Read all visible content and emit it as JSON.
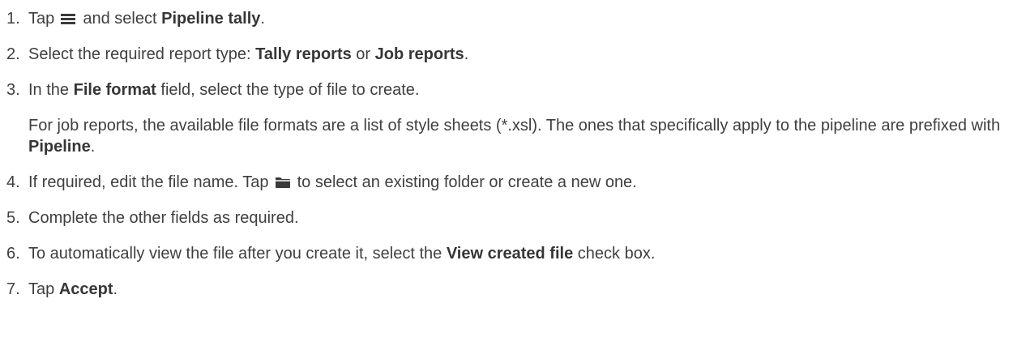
{
  "steps": [
    {
      "number": "1.",
      "text_before": "Tap",
      "icon": "menu-icon",
      "text_mid": "and select",
      "bold": "Pipeline tally",
      "text_after": "."
    },
    {
      "number": "2.",
      "text_before": "Select the required report type:",
      "bold1": "Tally reports",
      "text_mid": "or",
      "bold2": "Job reports",
      "text_after": "."
    },
    {
      "number": "3.",
      "text_before": "In the",
      "bold": "File format",
      "text_after": "field, select the type of file to create.",
      "note_text": "For job reports, the available file formats are a list of style sheets (*.xsl). The ones that specifically apply to the pipeline are prefixed with",
      "note_bold": "Pipeline",
      "note_after": "."
    },
    {
      "number": "4.",
      "text_before": "If required, edit the file name. Tap",
      "icon": "folder-icon",
      "text_after": "to select an existing folder or create a new one."
    },
    {
      "number": "5.",
      "text": "Complete the other fields as required."
    },
    {
      "number": "6.",
      "text_before": "To automatically view the file after you create it, select the",
      "bold": "View created file",
      "text_after": "check box."
    },
    {
      "number": "7.",
      "text_before": "Tap",
      "bold": "Accept",
      "text_after": "."
    }
  ]
}
